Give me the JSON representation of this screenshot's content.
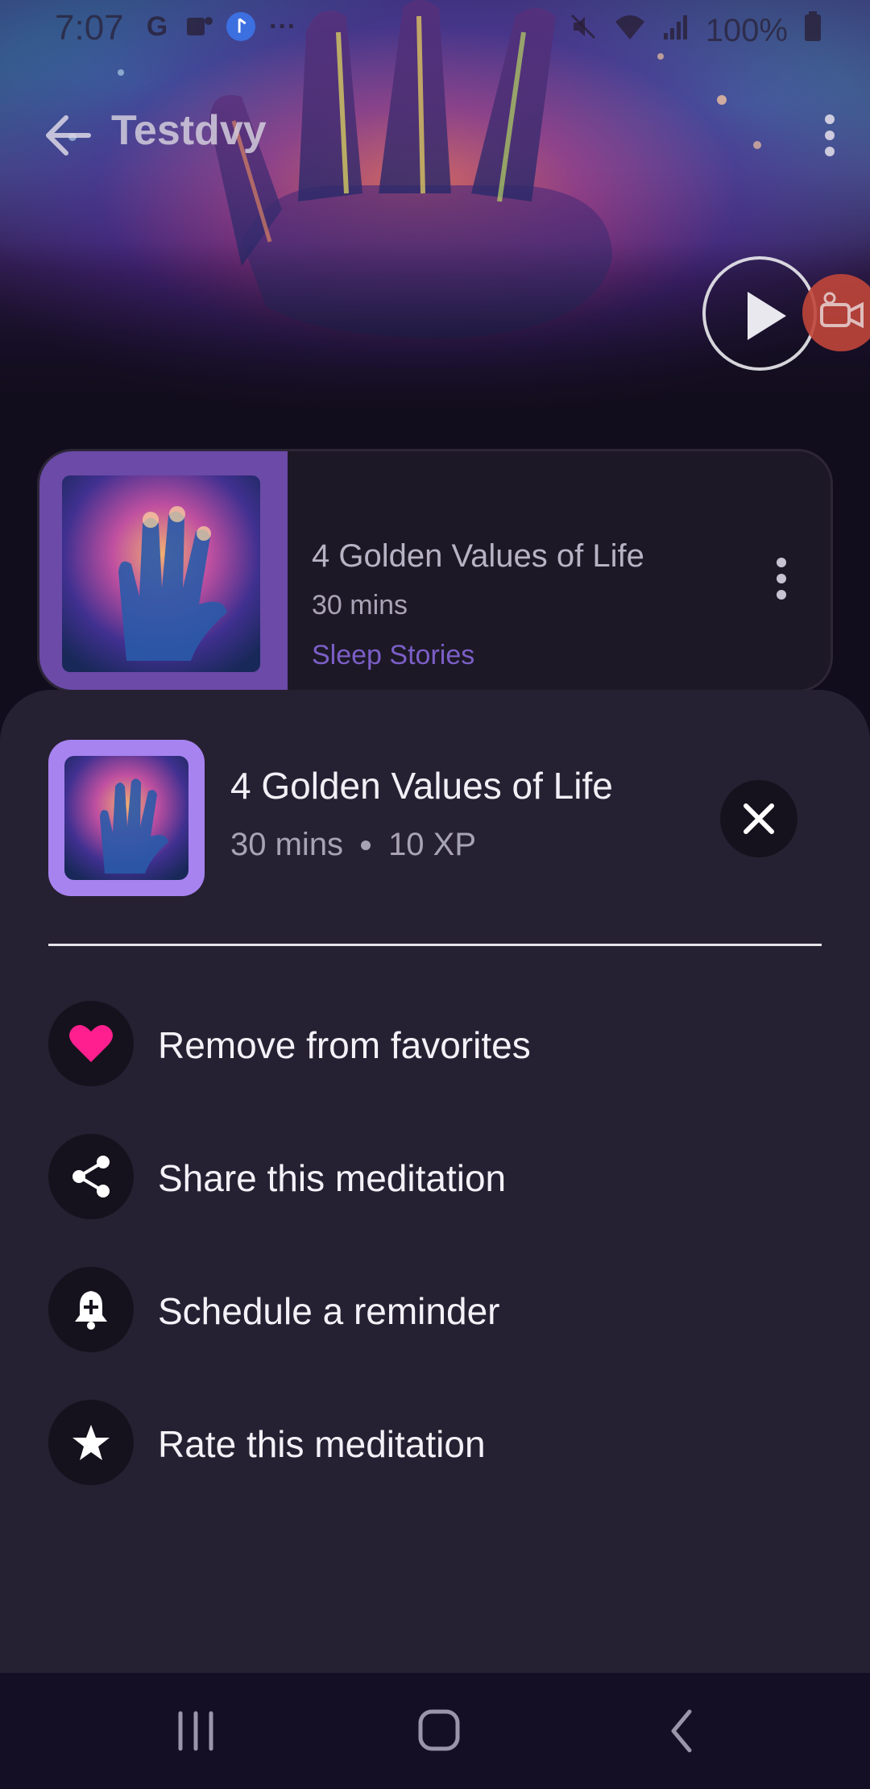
{
  "status_bar": {
    "time": "7:07",
    "battery": "100%",
    "left_icons": [
      "google-icon",
      "teams-icon",
      "app-icon",
      "more-icon"
    ],
    "right_icons": [
      "mute-icon",
      "wifi-icon",
      "signal-icon",
      "battery-icon"
    ]
  },
  "top_bar": {
    "title": "Testdvy"
  },
  "card": {
    "title": "4 Golden Values of Life",
    "duration": "30 mins",
    "category": "Sleep Stories"
  },
  "sheet": {
    "title": "4 Golden Values of Life",
    "duration": "30 mins",
    "xp": "10 XP",
    "menu": [
      {
        "label": "Remove from favorites",
        "icon": "heart-icon"
      },
      {
        "label": "Share this meditation",
        "icon": "share-icon"
      },
      {
        "label": "Schedule a reminder",
        "icon": "bell-plus-icon"
      },
      {
        "label": "Rate this meditation",
        "icon": "star-icon"
      }
    ]
  },
  "colors": {
    "accent_purple": "#a783f0",
    "category_purple": "#7b5fc7",
    "heart_pink": "#ff1f8e",
    "sheet_bg": "#262132",
    "nav_bg": "#140f24"
  }
}
